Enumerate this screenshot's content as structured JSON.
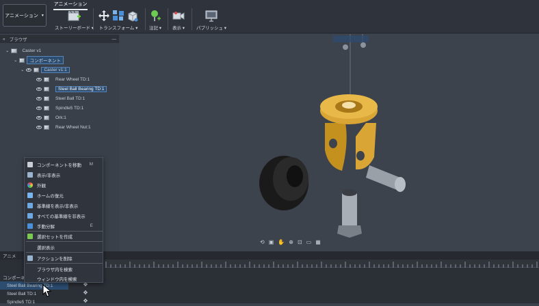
{
  "workspace": {
    "label": "アニメーション"
  },
  "ribbon": {
    "active_tab": "アニメーション",
    "groups": [
      {
        "label": "ストーリーボード",
        "icon": "storyboard-icon"
      },
      {
        "label": "トランスフォーム",
        "icon": "move-icon"
      },
      {
        "label": "注記",
        "icon": "annotation-pin-icon"
      },
      {
        "label": "表示",
        "icon": "camera-icon"
      },
      {
        "label": "パブリッシュ",
        "icon": "publish-video-icon"
      }
    ]
  },
  "browser": {
    "title": "ブラウザ",
    "root": "Caster v1",
    "components": "コンポーネント",
    "assembly": "Caster v1:1",
    "items": [
      "Rear Wheel TD:1",
      "Steel Ball Bearing TD:1",
      "Steel Ball TD:1",
      "Spindle5 TD:1",
      "Ork:1",
      "Rear Wheel Nut:1"
    ]
  },
  "context_menu": {
    "items": [
      {
        "label": "コンポーネントを移動",
        "shortcut": "M",
        "icon": "move-icon"
      },
      {
        "label": "表示/非表示",
        "shortcut": "",
        "icon": "visibility-icon"
      },
      {
        "label": "外観",
        "shortcut": "",
        "icon": "appearance-icon"
      },
      {
        "label": "ホームの復元",
        "shortcut": "",
        "icon": "home-icon"
      },
      {
        "label": "基準線を表示/非表示",
        "shortcut": "",
        "icon": "trail-lines-icon"
      },
      {
        "label": "すべての基準線を非表示",
        "shortcut": "",
        "icon": "hide-lines-icon"
      },
      {
        "label": "手動分解",
        "shortcut": "E",
        "icon": "explode-icon"
      },
      {
        "label": "選択セットを作成",
        "shortcut": "",
        "icon": "selection-set-icon"
      },
      {
        "label": "選択表示",
        "shortcut": "",
        "icon": ""
      },
      {
        "label": "アクションを削除",
        "shortcut": "",
        "icon": "delete-action-icon"
      },
      {
        "label": "ブラウザ内を検索",
        "shortcut": "",
        "icon": ""
      },
      {
        "label": "ウィンドウ内を検索",
        "shortcut": "",
        "icon": ""
      }
    ]
  },
  "timeline": {
    "header": "アニメ",
    "group": "コンポーネ",
    "rows": [
      "Steel Ball Bearing TD:1",
      "Steel Ball TD:1",
      "Spindle5 TD:1"
    ]
  },
  "colors": {
    "accent": "#2c4c70",
    "bearing": "#d9a534"
  }
}
